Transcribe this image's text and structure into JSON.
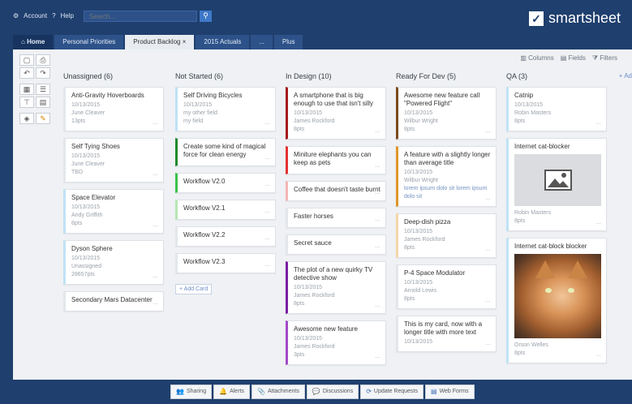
{
  "topbar": {
    "menu": [
      "Account",
      "Help"
    ],
    "search_placeholder": "Search...",
    "logo_text": "smartsheet"
  },
  "tabs": [
    {
      "label": "Home"
    },
    {
      "label": "Personal Priorities"
    },
    {
      "label": "Product Backlog"
    },
    {
      "label": "2015 Actuals"
    },
    {
      "label": "..."
    },
    {
      "label": "Plus"
    }
  ],
  "view_controls": [
    "Columns",
    "Fields",
    "Filters"
  ],
  "add_column_label": "+ Ad",
  "add_card_label": "+ Add Card",
  "columns": [
    {
      "header": "Unassigned (6)",
      "cards": [
        {
          "title": "Anti-Gravity Hoverboards",
          "meta": [
            "10/13/2015",
            "June Cleaver",
            "13pts"
          ],
          "color": "#e3e7ec"
        },
        {
          "title": "Self Tying Shoes",
          "meta": [
            "10/13/2015",
            "June Cleaver",
            "TBD"
          ],
          "color": "#e3e7ec"
        },
        {
          "title": "Space Elevator",
          "meta": [
            "10/13/2015",
            "Andy Griffith",
            "8pts"
          ],
          "color": "#bfe3f5"
        },
        {
          "title": "Dyson Sphere",
          "meta": [
            "10/13/2015",
            "Unassigned",
            "28657pts"
          ],
          "color": "#bfe3f5"
        },
        {
          "title": "Secondary Mars Datacenter",
          "meta": [],
          "color": "#e3e7ec"
        }
      ]
    },
    {
      "header": "Not Started (6)",
      "cards": [
        {
          "title": "Self Driving Bicycles",
          "meta": [
            "10/13/2015",
            "my other field",
            "my field"
          ],
          "color": "#bfe3f5"
        },
        {
          "title": "Create some kind of magical force for clean energy",
          "meta": [],
          "color": "#1e8a2b"
        },
        {
          "title": "Workflow V2.0",
          "meta": [],
          "color": "#39c24a"
        },
        {
          "title": "Workflow V2.1",
          "meta": [],
          "color": "#b5e7b4"
        },
        {
          "title": "Workflow V2.2",
          "meta": [],
          "color": "#e3e7ec"
        },
        {
          "title": "Workflow V2.3",
          "meta": [],
          "color": "#e3e7ec"
        }
      ]
    },
    {
      "header": "In Design (10)",
      "cards": [
        {
          "title": "A smartphone that is big enough to use that isn't silly",
          "meta": [
            "10/13/2015",
            "James Rockford",
            "8pts"
          ],
          "color": "#a51b1b"
        },
        {
          "title": "Miniture elephants you can keep as pets",
          "meta": [],
          "color": "#e53030"
        },
        {
          "title": "Coffee that doesn't taste burnt",
          "meta": [],
          "color": "#f3b6b6"
        },
        {
          "title": "Faster horses",
          "meta": [],
          "color": "#e3e7ec"
        },
        {
          "title": "Secret sauce",
          "meta": [],
          "color": "#e3e7ec"
        },
        {
          "title": "The plot of a new quirky TV detective show",
          "meta": [
            "10/13/2015",
            "James Rockford",
            "8pts"
          ],
          "color": "#7b1fa2"
        },
        {
          "title": "Awesome new feature",
          "meta": [
            "10/13/2015",
            "James Rockford",
            "3pts"
          ],
          "color": "#a24ac6"
        }
      ]
    },
    {
      "header": "Ready For Dev (5)",
      "cards": [
        {
          "title": "Awesome new feature call \"Powered Flight\"",
          "meta": [
            "10/13/2015",
            "Wilbur Wright",
            "8pts"
          ],
          "color": "#7a4a1c"
        },
        {
          "title": "A feature with a slightly longer than average title",
          "meta": [
            "10/13/2015",
            "Wilbur Wright",
            "lorem ipsum dolo sit lorem ipsum dolo sit"
          ],
          "color": "#e0962a"
        },
        {
          "title": "Deep-dish pizza",
          "meta": [
            "10/13/2015",
            "James Rockford",
            "8pts"
          ],
          "color": "#f5d6a8"
        },
        {
          "title": "P-4 Space Modulator",
          "meta": [
            "10/13/2015",
            "Arnold Lewis",
            "8pts"
          ],
          "color": "#e3e7ec"
        },
        {
          "title": "This is my card, now with a longer title with more text",
          "meta": [
            "10/13/2015"
          ],
          "color": "#e3e7ec"
        }
      ]
    },
    {
      "header": "QA (3)",
      "cards": [
        {
          "title": "Catnip",
          "meta": [
            "10/13/2015",
            "Robin Masters",
            "8pts"
          ],
          "color": "#bfe3f5"
        },
        {
          "title": "Internet cat-blocker",
          "meta": [
            "Robin Masters",
            "8pts"
          ],
          "color": "#bfe3f5",
          "image": "placeholder"
        },
        {
          "title": "Internet cat-block blocker",
          "meta": [
            "Orson Welles",
            "8pts"
          ],
          "color": "#bfe3f5",
          "image": "cat"
        }
      ]
    }
  ],
  "bottombar": [
    {
      "label": "Sharing",
      "icon": "people-icon"
    },
    {
      "label": "Alerts",
      "icon": "bell-icon"
    },
    {
      "label": "Attachments",
      "icon": "paperclip-icon"
    },
    {
      "label": "Discussions",
      "icon": "chat-icon"
    },
    {
      "label": "Update Requests",
      "icon": "update-icon"
    },
    {
      "label": "Web Forms",
      "icon": "form-icon"
    }
  ]
}
